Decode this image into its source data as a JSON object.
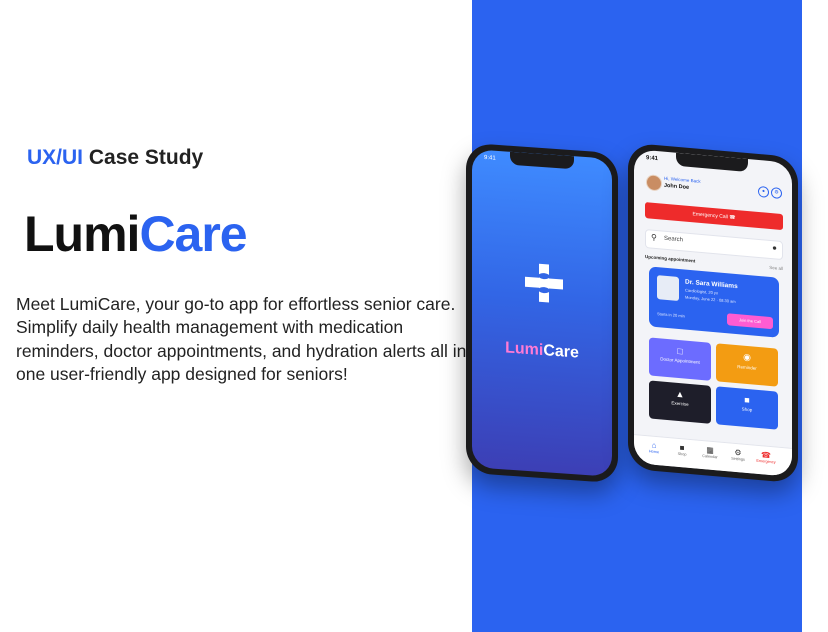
{
  "heading": {
    "accent": "UX/UI",
    "rest": " Case Study"
  },
  "brand": {
    "part1": "Lumi",
    "part2": "Care"
  },
  "description": "Meet LumiCare, your go-to app for effortless senior care. Simplify daily health management with medication reminders, doctor appointments, and hydration alerts all in one user-friendly app designed for seniors!",
  "colors": {
    "accent": "#2b63f0",
    "panel": "#2b63f0",
    "emergency": "#ee2b2b",
    "pink": "#ff5cd2"
  },
  "splash": {
    "time": "9:41",
    "name_part1": "Lumi",
    "name_part2": "Care"
  },
  "home": {
    "time": "9:41",
    "greeting": "Hi, Welcome Back",
    "user_name": "John Doe",
    "emergency_label": "Emergency Call",
    "search_placeholder": "Search",
    "section_title": "Upcoming appointment",
    "see_all": "See all",
    "doctor": {
      "name": "Dr. Sara Williams",
      "specialty": "Cardiologist, 20 yo",
      "date": "Monday, June 22 · 08:30 am",
      "starts": "Starts in 20 min",
      "join": "Join the Call"
    },
    "tiles": [
      {
        "label": "Doctor Appointment",
        "icon": "calendar-icon"
      },
      {
        "label": "Reminder",
        "icon": "pill-icon"
      },
      {
        "label": "Exercise",
        "icon": "walk-icon"
      },
      {
        "label": "Shop",
        "icon": "cart-icon"
      }
    ],
    "nav": [
      {
        "label": "Home",
        "icon": "home-icon"
      },
      {
        "label": "Shop",
        "icon": "cart-icon"
      },
      {
        "label": "Calendar",
        "icon": "calendar-icon"
      },
      {
        "label": "Settings",
        "icon": "gear-icon"
      },
      {
        "label": "Emergency",
        "icon": "phone-icon"
      }
    ]
  }
}
